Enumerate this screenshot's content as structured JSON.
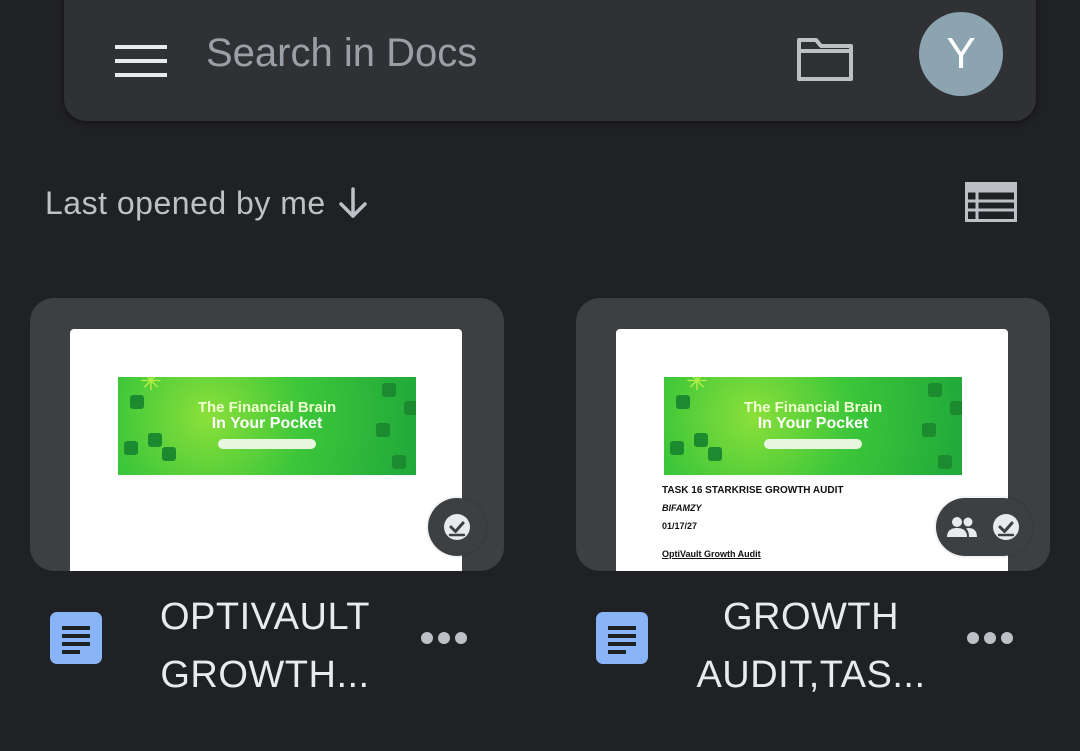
{
  "search": {
    "placeholder": "Search in Docs"
  },
  "account": {
    "avatar_initial": "Y",
    "avatar_color": "#8ba4b0"
  },
  "icons": {
    "menu": "hamburger-menu-icon",
    "folder": "folder-icon",
    "sort_direction": "arrow-down-icon",
    "view_toggle": "list-view-icon",
    "doc_type": "google-docs-icon",
    "shared": "people-icon",
    "offline": "offline-available-check-icon",
    "more": "more-horizontal-icon"
  },
  "sort": {
    "label": "Last opened by me"
  },
  "colors": {
    "background": "#202124",
    "surface": "#303134",
    "card_frame": "#3c4043",
    "docs_blue": "#8ab4f8"
  },
  "files": [
    {
      "title_line1": "OPTIVAULT",
      "title_line2": "GROWTH...",
      "shared": false,
      "available_offline": true,
      "thumbnail": {
        "banner_line1": "The Financial  Brain",
        "banner_line2": "In Your Pocket"
      }
    },
    {
      "title_line1": "GROWTH",
      "title_line2": "AUDIT,TAS...",
      "shared": true,
      "available_offline": true,
      "thumbnail": {
        "banner_line1": "The Financial  Brain",
        "banner_line2": "In Your Pocket",
        "doc_title": "TASK 16 STARKRISE GROWTH AUDIT",
        "doc_by": "BIFAMZY",
        "doc_date": "01/17/27",
        "doc_heading": "OptiVault Growth Audit"
      }
    }
  ]
}
